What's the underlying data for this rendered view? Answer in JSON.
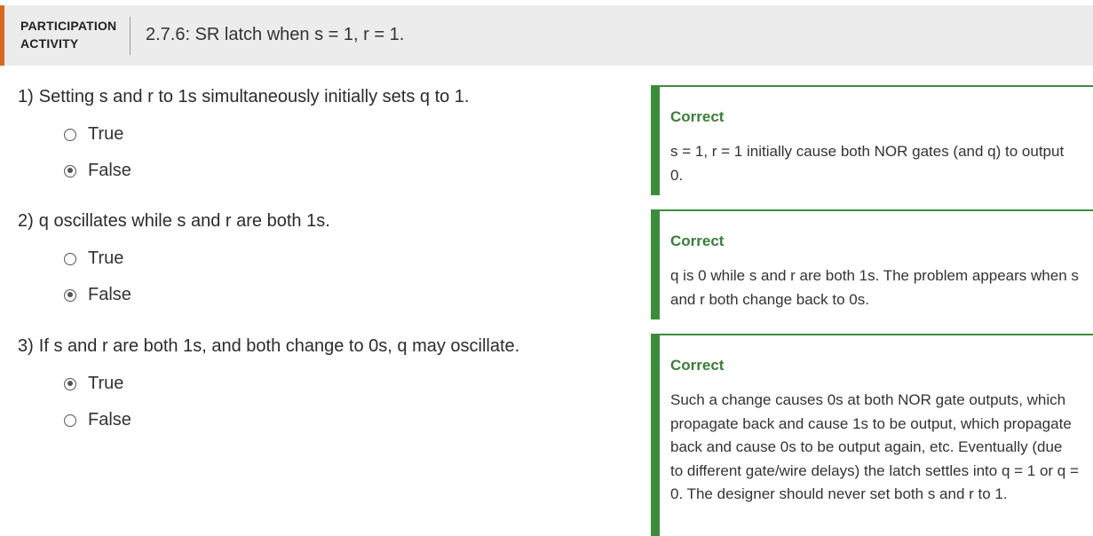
{
  "header": {
    "kicker": "PARTICIPATION ACTIVITY",
    "title": "2.7.6: SR latch when s = 1, r = 1."
  },
  "questions": [
    {
      "number": "1)",
      "text": "Setting s and r to 1s simultaneously initially sets q to 1.",
      "options": [
        {
          "label": "True",
          "selected": false
        },
        {
          "label": "False",
          "selected": true
        }
      ],
      "feedback": {
        "status": "Correct",
        "text": "s = 1, r = 1 initially cause both NOR gates (and q) to output 0."
      }
    },
    {
      "number": "2)",
      "text": "q oscillates while s and r are both 1s.",
      "options": [
        {
          "label": "True",
          "selected": false
        },
        {
          "label": "False",
          "selected": true
        }
      ],
      "feedback": {
        "status": "Correct",
        "text": "q is 0 while s and r are both 1s. The problem appears when s and r both change back to 0s."
      }
    },
    {
      "number": "3)",
      "text": "If s and r are both 1s, and both change to 0s, q may oscillate.",
      "options": [
        {
          "label": "True",
          "selected": true
        },
        {
          "label": "False",
          "selected": false
        }
      ],
      "feedback": {
        "status": "Correct",
        "text": "Such a change causes 0s at both NOR gate outputs, which propagate back and cause 1s to be output, which propagate back and cause 0s to be output again, etc. Eventually (due to different gate/wire delays) the latch settles into q = 1 or q = 0. The designer should never set both s and r to 1."
      }
    }
  ],
  "colors": {
    "accent": "#d66a1f",
    "correct": "#3c8c3c"
  }
}
